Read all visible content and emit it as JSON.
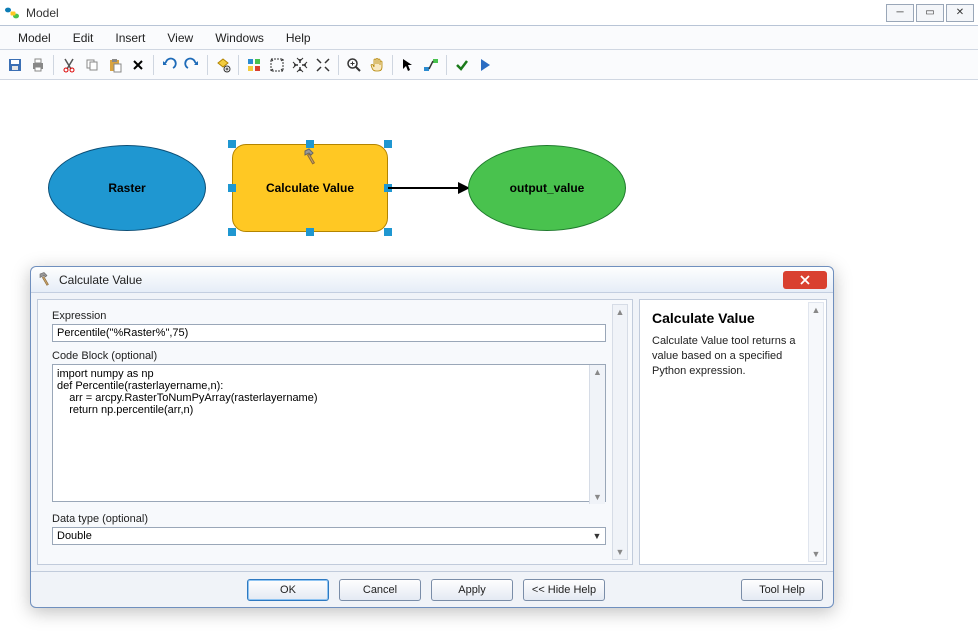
{
  "window": {
    "title": "Model"
  },
  "menu": {
    "model": "Model",
    "edit": "Edit",
    "insert": "Insert",
    "view": "View",
    "windows": "Windows",
    "help": "Help"
  },
  "nodes": {
    "raster": {
      "label": "Raster",
      "fill": "#1f97d1",
      "stroke": "#0b4e76"
    },
    "calc": {
      "label": "Calculate Value",
      "fill": "#ffc823",
      "stroke": "#b38400"
    },
    "output": {
      "label": "output_value",
      "fill": "#49c24e",
      "stroke": "#1f7a2d"
    }
  },
  "dialog": {
    "title": "Calculate Value",
    "expression_label": "Expression",
    "expression_value": "Percentile(\"%Raster%\",75)",
    "codeblock_label": "Code Block (optional)",
    "codeblock_value": "import numpy as np\ndef Percentile(rasterlayername,n):\n    arr = arcpy.RasterToNumPyArray(rasterlayername)\n    return np.percentile(arr,n)",
    "datatype_label": "Data type (optional)",
    "datatype_value": "Double",
    "buttons": {
      "ok": "OK",
      "cancel": "Cancel",
      "apply": "Apply",
      "hidehelp": "<< Hide Help",
      "toolhelp": "Tool Help"
    },
    "help": {
      "heading": "Calculate Value",
      "body": "Calculate Value tool returns a value based on a specified Python expression."
    }
  }
}
